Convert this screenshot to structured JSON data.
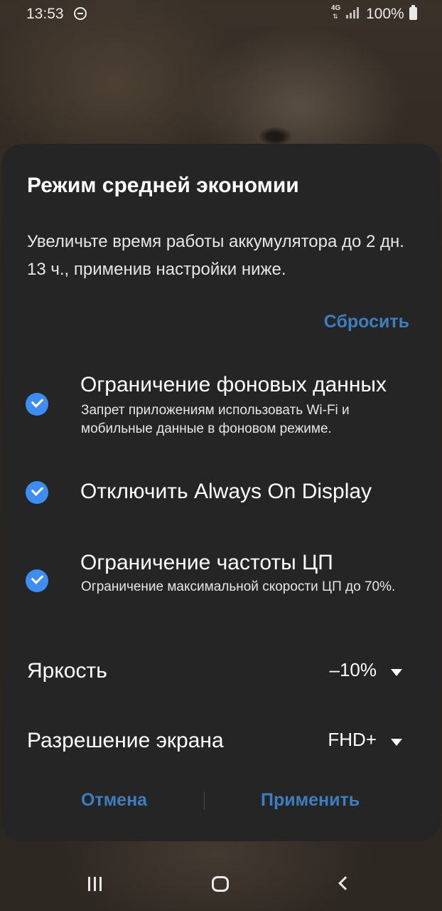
{
  "status_bar": {
    "time": "13:53",
    "network_type": "4G",
    "battery_percent": "100%",
    "icons": [
      "do-not-disturb-icon",
      "signal-icon",
      "battery-icon"
    ]
  },
  "dialog": {
    "title": "Режим средней экономии",
    "description": "Увеличьте время работы аккумулятора до 2 дн. 13 ч., применив настройки ниже.",
    "reset_label": "Сбросить",
    "options": [
      {
        "title": "Ограничение фоновых данных",
        "subtitle": "Запрет приложениям использовать Wi-Fi и мобильные данные в фоновом режиме.",
        "checked": true
      },
      {
        "title": "Отключить Always On Display",
        "subtitle": "",
        "checked": true
      },
      {
        "title": "Ограничение частоты ЦП",
        "subtitle": "Ограничение максимальной скорости ЦП до 70%.",
        "checked": true
      }
    ],
    "brightness": {
      "label": "Яркость",
      "value": "–10%"
    },
    "resolution": {
      "label": "Разрешение экрана",
      "value": "FHD+"
    },
    "cancel_label": "Отмена",
    "apply_label": "Применить"
  },
  "colors": {
    "accent": "#3d8df5",
    "button_text": "#3d7ebf",
    "dialog_bg": "#252525"
  },
  "nav_bar": {
    "icons": [
      "recents-icon",
      "home-icon",
      "back-icon"
    ]
  }
}
